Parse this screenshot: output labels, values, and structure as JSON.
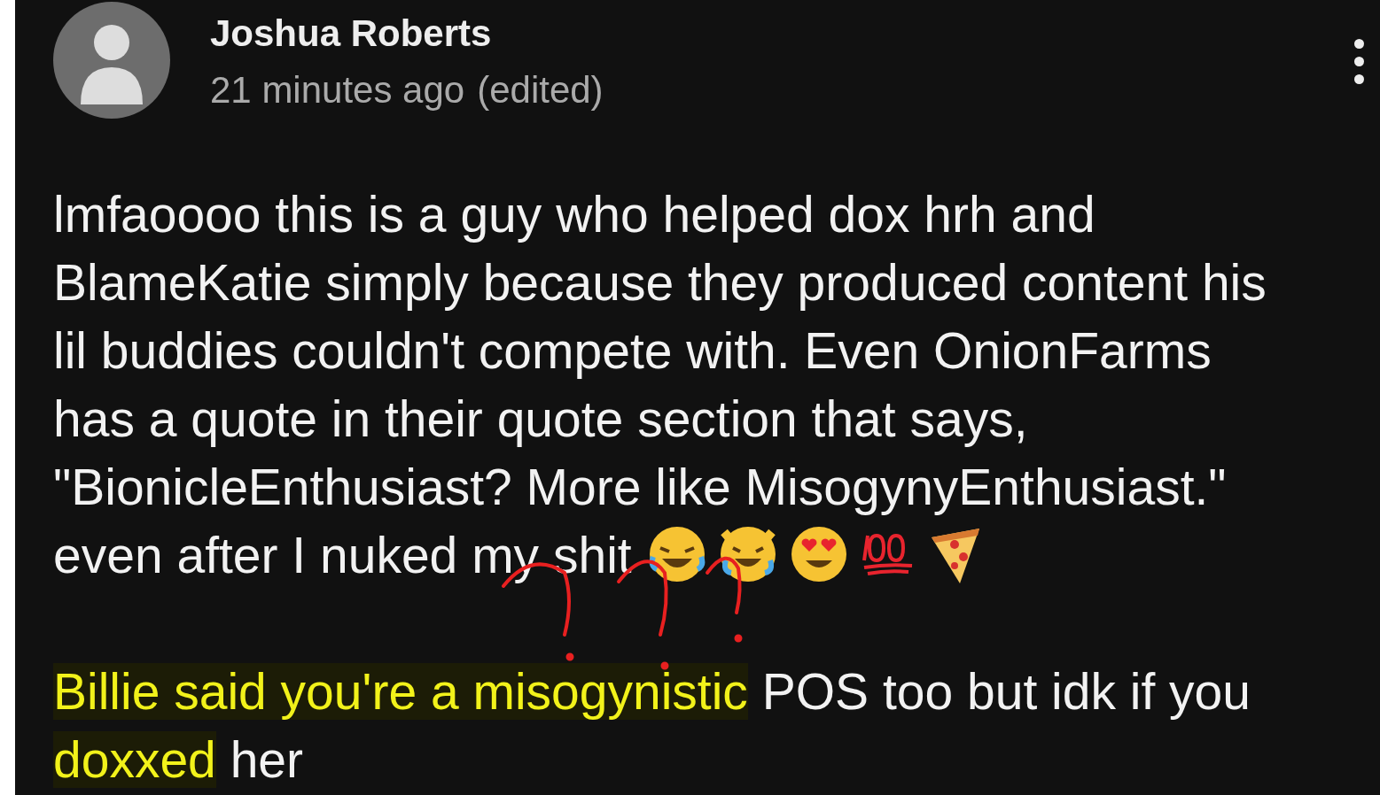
{
  "comment": {
    "author": "Joshua Roberts",
    "time": "21 minutes ago",
    "edited": "(edited)",
    "lines": [
      "lmfaoooo this is a guy who helped dox hrh and",
      "BlameKatie simply because they produced content his",
      "lil buddies couldn't compete with. Even OnionFarms",
      "has a quote in their quote section that says,",
      "\"BionicleEnthusiast? More like MisogynyEnthusiast.\"",
      "even after I nuked my shit"
    ],
    "reply_segments": [
      {
        "text": "Billie said you're a misogynistic",
        "highlighted": true
      },
      {
        "text": " POS too but idk if you ",
        "highlighted": false
      },
      {
        "text": "doxxed",
        "highlighted": true
      },
      {
        "text": " her",
        "highlighted": false
      }
    ]
  }
}
